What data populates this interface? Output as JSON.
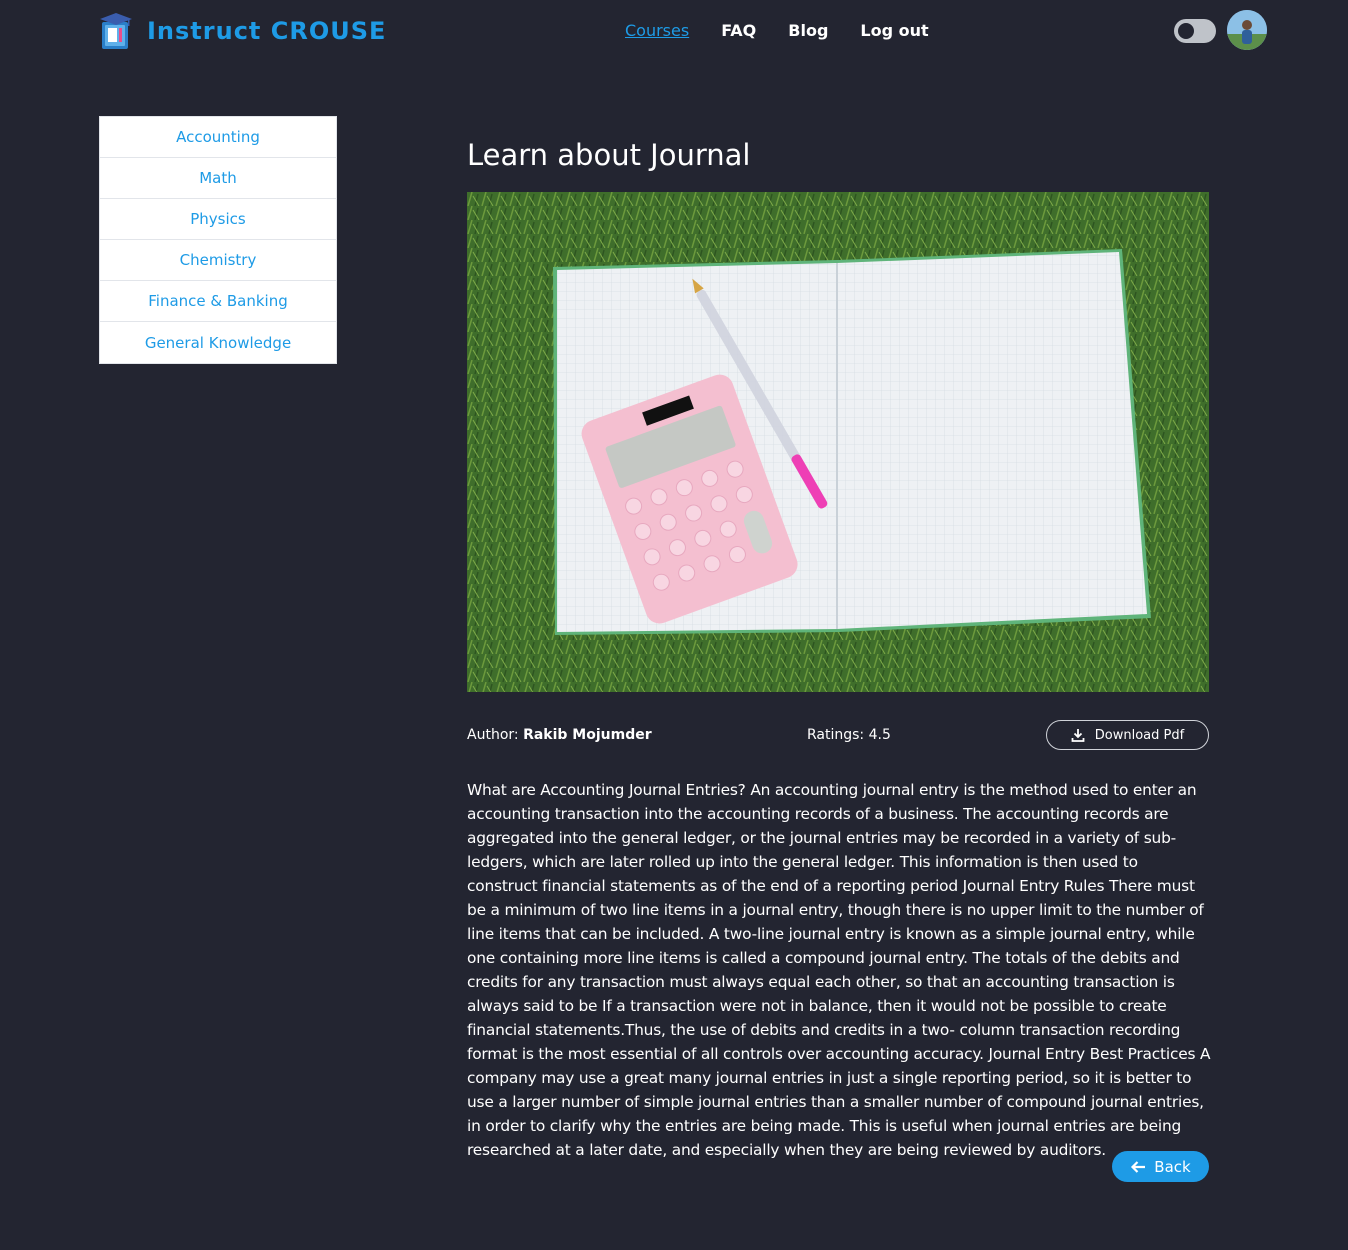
{
  "brand": {
    "name": "Instruct CROUSE",
    "logo_icon": "book-graduation-cap-icon"
  },
  "nav": {
    "items": [
      {
        "label": "Courses",
        "active": true
      },
      {
        "label": "FAQ",
        "active": false
      },
      {
        "label": "Blog",
        "active": false
      },
      {
        "label": "Log out",
        "active": false
      }
    ]
  },
  "header": {
    "theme_toggle": "off",
    "avatar_icon": "user-avatar"
  },
  "sidebar": {
    "items": [
      {
        "label": "Accounting"
      },
      {
        "label": "Math"
      },
      {
        "label": "Physics"
      },
      {
        "label": "Chemistry"
      },
      {
        "label": "Finance & Banking"
      },
      {
        "label": "General Knowledge"
      }
    ]
  },
  "course": {
    "title": "Learn about Journal",
    "author_label": "Author:",
    "author_name": "Rakib Mojumder",
    "ratings_label": "Ratings:",
    "ratings_value": "4.5",
    "download_label": "Download Pdf",
    "description": "What are Accounting Journal Entries? An accounting journal entry is the method used to enter an accounting transaction into the accounting records of a business. The accounting records are aggregated into the general ledger, or the journal entries may be recorded in a variety of sub-ledgers, which are later rolled up into the general ledger. This information is then used to construct financial statements as of the end of a reporting period Journal Entry Rules There must be a minimum of two line items in a journal entry, though there is no upper limit to the number of line items that can be included. A two-line journal entry is known as a simple journal entry, while one containing more line items is called a compound journal entry. The totals of the debits and credits for any transaction must always equal each other, so that an accounting transaction is always said to be If a transaction were not in balance, then it would not be possible to create financial statements.Thus, the use of debits and credits in a two- column transaction recording format is the most essential of all controls over accounting accuracy. Journal Entry Best Practices A company may use a great many journal entries in just a single reporting period, so it is better to use a larger number of simple journal entries than a smaller number of compound journal entries, in order to clarify why the entries are being made. This is useful when journal entries are being researched at a later date, and especially when they are being reviewed by auditors.",
    "back_label": "Back"
  },
  "colors": {
    "background": "#232531",
    "accent": "#1e9be6",
    "sidebar_bg": "#ffffff",
    "text": "#ffffff"
  }
}
